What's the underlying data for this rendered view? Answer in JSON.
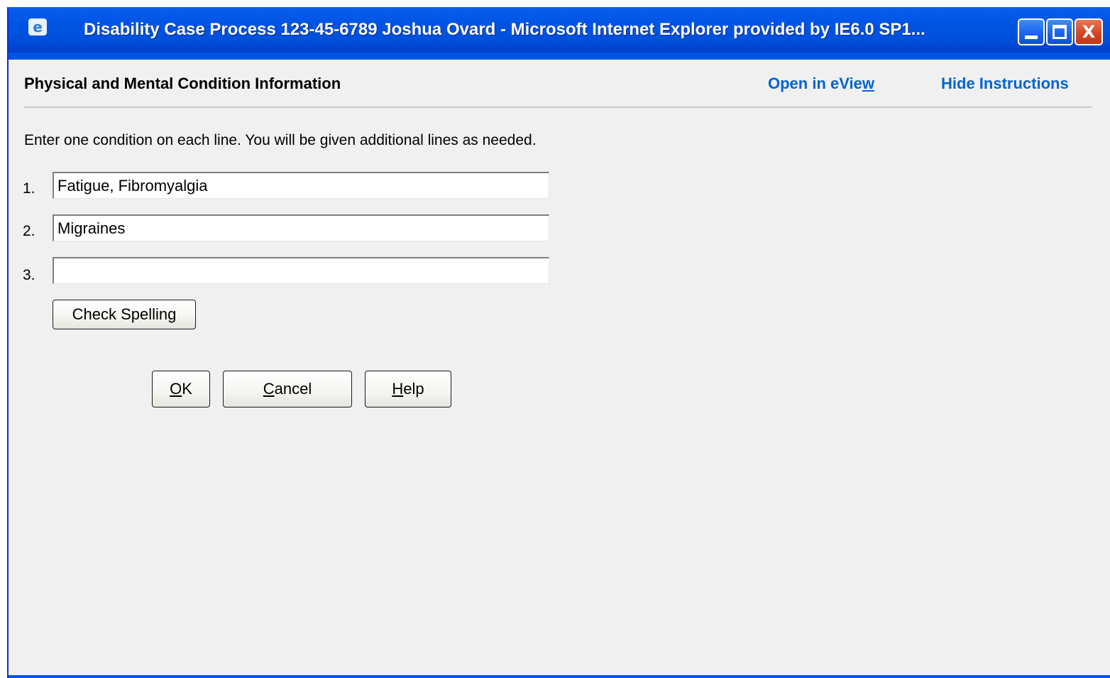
{
  "window": {
    "title": "Disability Case Process 123-45-6789 Joshua Ovard  -  Microsoft Internet Explorer provided by IE6.0 SP1...",
    "icon": "ie-icon",
    "controls": {
      "minimize": "minimize-icon",
      "maximize": "maximize-icon",
      "close_label": "X"
    }
  },
  "header": {
    "title": "Physical and Mental Condition Information",
    "links": {
      "eview_prefix": "Open in eVie",
      "eview_accel": "w",
      "hide_instructions": "Hide Instructions"
    }
  },
  "instructions": "Enter one condition on each line.  You will be given additional lines as needed.",
  "conditions": [
    {
      "number": "1.",
      "value": "Fatigue, Fibromyalgia"
    },
    {
      "number": "2.",
      "value": "Migraines"
    },
    {
      "number": "3.",
      "value": ""
    }
  ],
  "buttons": {
    "check_spelling": "Check Spelling",
    "ok": {
      "accel": "O",
      "rest": "K"
    },
    "cancel": {
      "accel": "C",
      "rest": "ancel"
    },
    "help": {
      "accel": "H",
      "rest": "elp"
    }
  },
  "colors": {
    "titlebar": "#0054e3",
    "link": "#0064d2",
    "background": "#f0f0f0",
    "close_button": "#d24420"
  }
}
